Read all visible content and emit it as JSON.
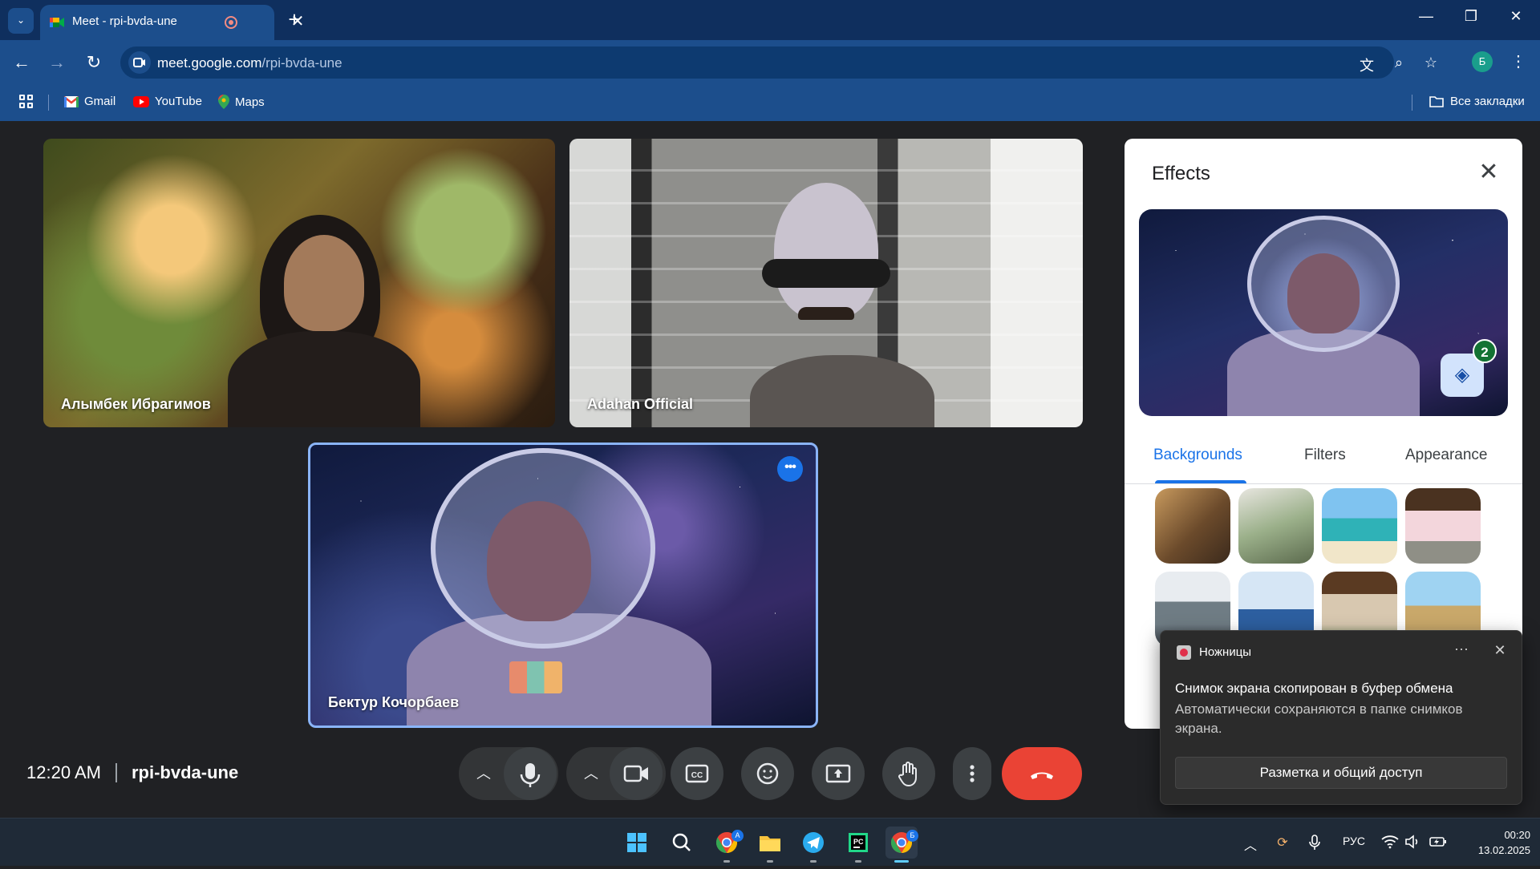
{
  "browser": {
    "tab_title": "Meet - rpi-bvda-une",
    "tab_close": "✕",
    "new_tab": "+",
    "url_host": "meet.google.com",
    "url_path": "/rpi-bvda-une",
    "profile_initial": "Б",
    "window_controls": {
      "minimize": "—",
      "restore": "❐",
      "close": "✕"
    },
    "bookmarks": [
      {
        "label": "Gmail",
        "icon": "gmail-icon"
      },
      {
        "label": "YouTube",
        "icon": "youtube-icon"
      },
      {
        "label": "Maps",
        "icon": "maps-icon"
      }
    ],
    "all_bookmarks": "Все закладки"
  },
  "meeting": {
    "time": "12:20 AM",
    "code": "rpi-bvda-une",
    "participants": [
      {
        "name": "Алымбек Ибрагимов"
      },
      {
        "name": "Adahan Official"
      },
      {
        "name": "Бектур Кочорбаев"
      }
    ],
    "controls": [
      "mic-icon",
      "camera-icon",
      "captions-icon",
      "emoji-icon",
      "present-icon",
      "raise-hand-icon",
      "more-options-icon",
      "end-call-icon"
    ]
  },
  "effects": {
    "title": "Effects",
    "layer_count": "2",
    "tabs": [
      {
        "label": "Backgrounds",
        "active": true
      },
      {
        "label": "Filters",
        "active": false
      },
      {
        "label": "Appearance",
        "active": false
      }
    ]
  },
  "toast": {
    "app": "Ножницы",
    "heading": "Снимок экрана скопирован в буфер обмена",
    "body": "Автоматически сохраняются в папке снимков экрана.",
    "button": "Разметка и общий доступ"
  },
  "taskbar": {
    "language": "РУС",
    "time": "00:20",
    "date": "13.02.2025",
    "chrome_badge_1": "A",
    "chrome_badge_2": "Б"
  },
  "colors": {
    "accent": "#1a73e8",
    "end_call": "#ea4335",
    "badge_green": "#137333",
    "active_tile_border": "#8ab4f8"
  }
}
